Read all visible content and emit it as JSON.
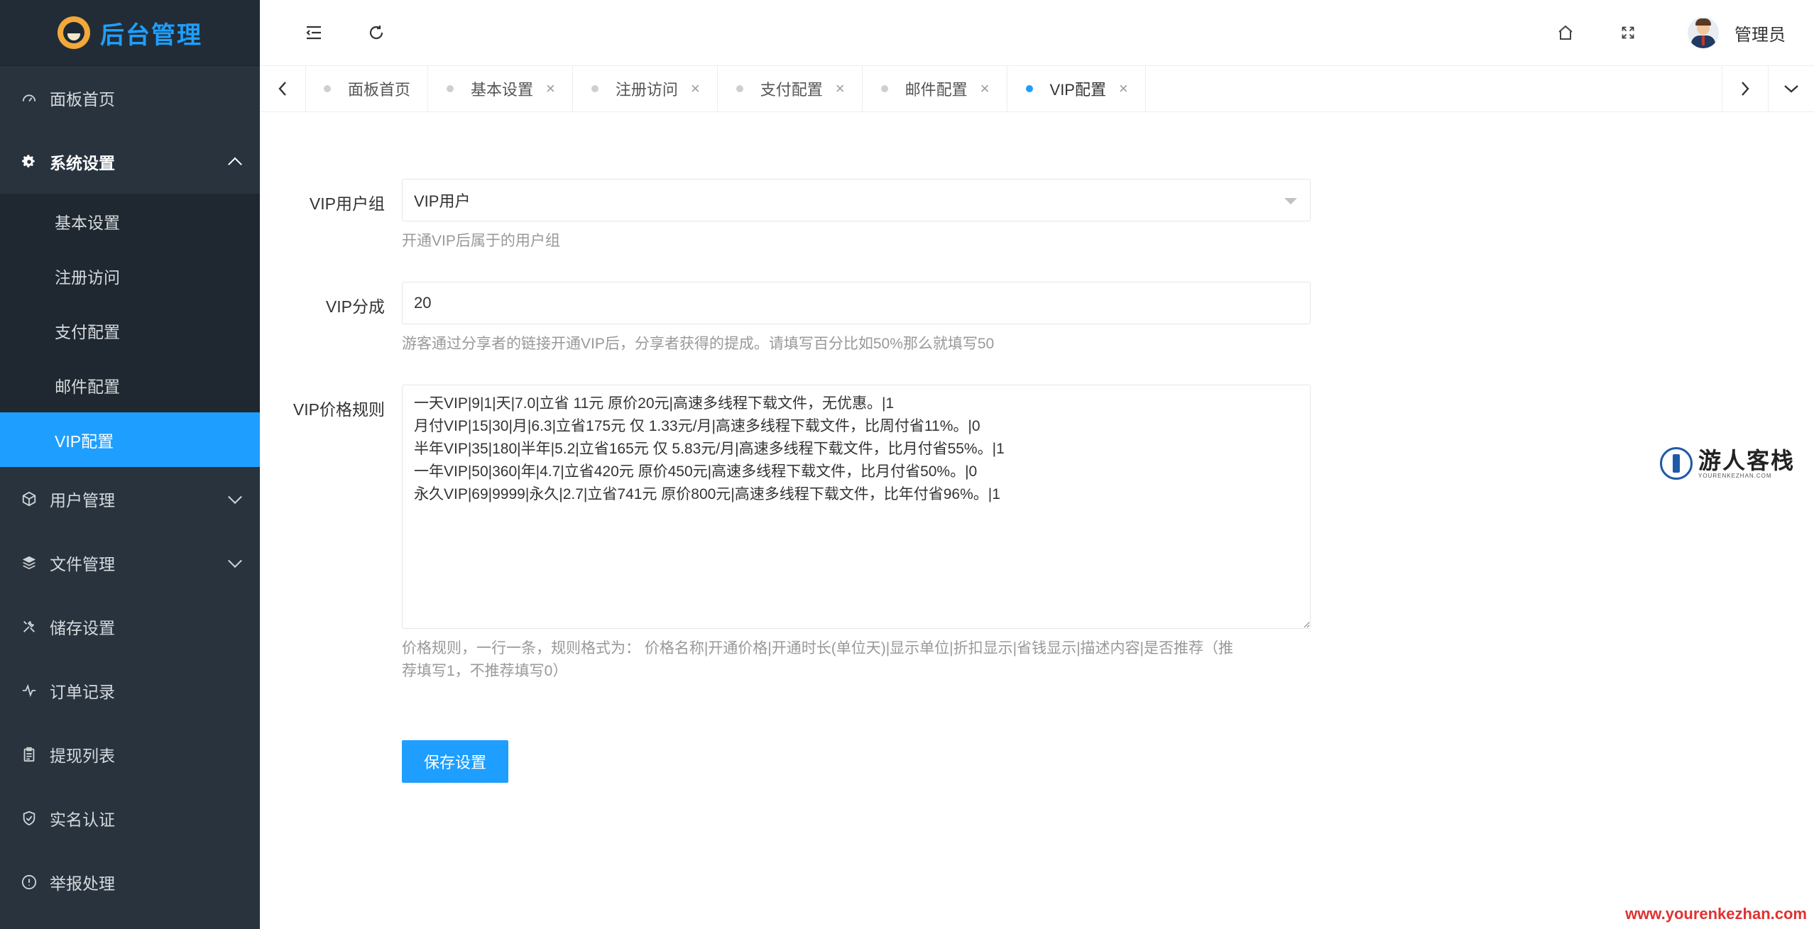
{
  "brand": {
    "title": "后台管理"
  },
  "sidebar": {
    "items": [
      {
        "label": "面板首页",
        "icon": "dashboard-icon"
      },
      {
        "label": "系统设置",
        "icon": "gear-icon",
        "open": true,
        "children": [
          {
            "label": "基本设置"
          },
          {
            "label": "注册访问"
          },
          {
            "label": "支付配置"
          },
          {
            "label": "邮件配置"
          },
          {
            "label": "VIP配置",
            "active": true
          }
        ]
      },
      {
        "label": "用户管理",
        "icon": "cube-icon"
      },
      {
        "label": "文件管理",
        "icon": "layers-icon"
      },
      {
        "label": "储存设置",
        "icon": "tools-icon"
      },
      {
        "label": "订单记录",
        "icon": "pulse-icon"
      },
      {
        "label": "提现列表",
        "icon": "clipboard-icon"
      },
      {
        "label": "实名认证",
        "icon": "shield-check-icon"
      },
      {
        "label": "举报处理",
        "icon": "info-icon"
      }
    ]
  },
  "header": {
    "username": "管理员"
  },
  "tabs": [
    {
      "label": "面板首页",
      "closable": false
    },
    {
      "label": "基本设置",
      "closable": true
    },
    {
      "label": "注册访问",
      "closable": true
    },
    {
      "label": "支付配置",
      "closable": true
    },
    {
      "label": "邮件配置",
      "closable": true
    },
    {
      "label": "VIP配置",
      "closable": true,
      "active": true
    }
  ],
  "form": {
    "vip_group": {
      "label": "VIP用户组",
      "value": "VIP用户",
      "help": "开通VIP后属于的用户组"
    },
    "vip_share": {
      "label": "VIP分成",
      "value": "20",
      "help": "游客通过分享者的链接开通VIP后，分享者获得的提成。请填写百分比如50%那么就填写50"
    },
    "vip_price": {
      "label": "VIP价格规则",
      "value": "一天VIP|9|1|天|7.0|立省 11元 原价20元|高速多线程下载文件，无优惠。|1\n月付VIP|15|30|月|6.3|立省175元 仅 1.33元/月|高速多线程下载文件，比周付省11%。|0\n半年VIP|35|180|半年|5.2|立省165元 仅 5.83元/月|高速多线程下载文件，比月付省55%。|1\n一年VIP|50|360|年|4.7|立省420元 原价450元|高速多线程下载文件，比月付省50%。|0\n永久VIP|69|9999|永久|2.7|立省741元 原价800元|高速多线程下载文件，比年付省96%。|1",
      "help_line1": "价格规则，一行一条，规则格式为： 价格名称|开通价格|开通时长(单位天)|显示单位|折扣显示|省钱显示|描述内容|是否推荐（推",
      "help_line2": "荐填写1，不推荐填写0）"
    },
    "save_label": "保存设置"
  },
  "watermark": {
    "title": "游人客栈",
    "sub": "YOURENKEZHAN.COM",
    "url": "www.yourenkezhan.com"
  }
}
